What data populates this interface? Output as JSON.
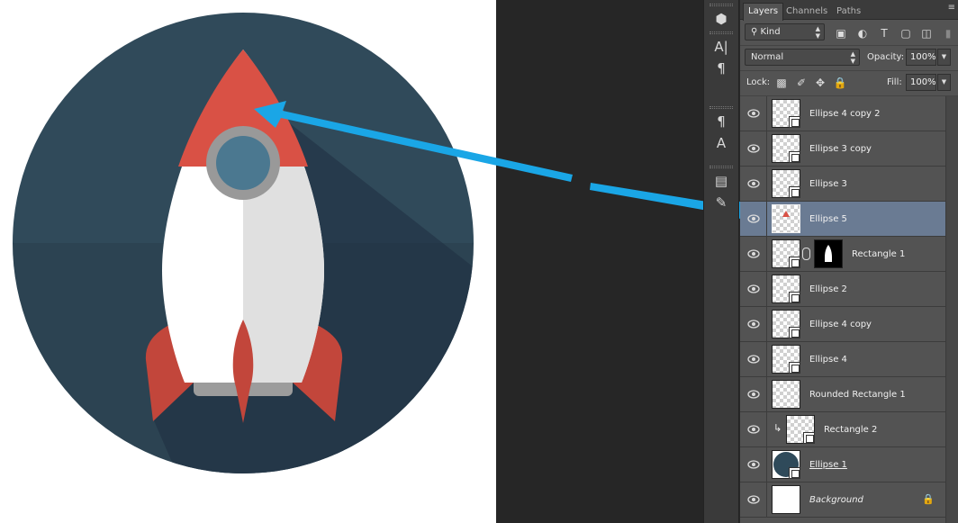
{
  "panel": {
    "tabs": [
      "Layers",
      "Channels",
      "Paths"
    ],
    "active_tab": "Layers",
    "menu_icon": "panel-menu-icon"
  },
  "filter": {
    "kind_label": "Kind",
    "filter_icons": [
      "image-filter-icon",
      "adjustment-filter-icon",
      "type-filter-icon",
      "shape-filter-icon",
      "smart-object-filter-icon"
    ]
  },
  "blend": {
    "mode": "Normal",
    "opacity_label": "Opacity:",
    "opacity_value": "100%"
  },
  "lock": {
    "label": "Lock:",
    "fill_label": "Fill:",
    "fill_value": "100%"
  },
  "layers": [
    {
      "name": "Ellipse 4 copy 2",
      "type": "shape",
      "selected": false
    },
    {
      "name": "Ellipse 3 copy",
      "type": "shape",
      "selected": false
    },
    {
      "name": "Ellipse 3",
      "type": "shape",
      "selected": false
    },
    {
      "name": "Ellipse 5",
      "type": "shape",
      "selected": true
    },
    {
      "name": "Rectangle 1",
      "type": "shape-with-mask",
      "selected": false
    },
    {
      "name": "Ellipse 2",
      "type": "shape",
      "selected": false
    },
    {
      "name": "Ellipse 4 copy",
      "type": "shape",
      "selected": false
    },
    {
      "name": "Ellipse 4",
      "type": "shape",
      "selected": false
    },
    {
      "name": "Rounded Rectangle 1",
      "type": "shape",
      "selected": false
    },
    {
      "name": "Rectangle 2",
      "type": "clipped-shape",
      "selected": false
    },
    {
      "name": "Ellipse 1",
      "type": "shape",
      "selected": false
    },
    {
      "name": "Background",
      "type": "background",
      "selected": false
    }
  ],
  "colors": {
    "circle_bg": "#2f4a5a",
    "rocket_red": "#d95145",
    "rocket_body": "#ffffff",
    "rocket_shade": "#e0e0e0",
    "window_ring": "#999999",
    "window_glass": "#4b7890",
    "fin_red": "#c2463b",
    "arrow_blue": "#1aa6e6",
    "selected_row": "#6a7b93"
  }
}
